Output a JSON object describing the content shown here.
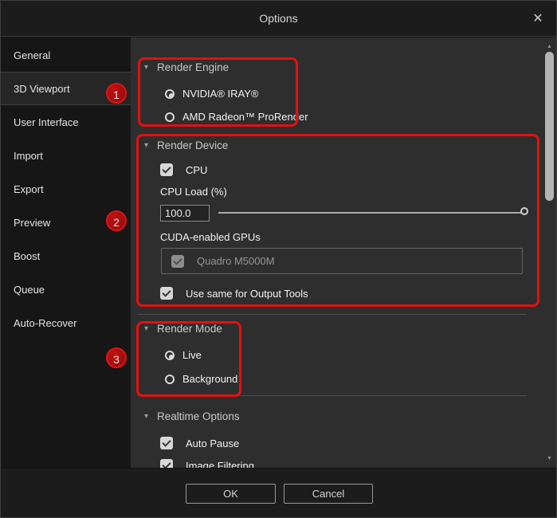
{
  "window": {
    "title": "Options"
  },
  "icons": {
    "close": "✕",
    "collapse": "▾",
    "scroll_up": "▲",
    "scroll_down": "▼"
  },
  "colors": {
    "annotation_red": "#e60f0f",
    "content_bg": "#2e2e2e",
    "sidebar_bg": "#161616",
    "control_fill": "#d7d7d7"
  },
  "sidebar": {
    "selected": "3D Viewport",
    "items": [
      {
        "label": "General"
      },
      {
        "label": "3D Viewport"
      },
      {
        "label": "User Interface"
      },
      {
        "label": "Import"
      },
      {
        "label": "Export"
      },
      {
        "label": "Preview"
      },
      {
        "label": "Boost"
      },
      {
        "label": "Queue"
      },
      {
        "label": "Auto-Recover"
      }
    ]
  },
  "annotations": {
    "badges": [
      {
        "number": "1"
      },
      {
        "number": "2"
      },
      {
        "number": "3"
      }
    ]
  },
  "sections": {
    "render_engine": {
      "title": "Render Engine",
      "options": [
        {
          "label": "NVIDIA® IRAY®",
          "selected": true
        },
        {
          "label": "AMD Radeon™ ProRender",
          "selected": false
        }
      ]
    },
    "render_device": {
      "title": "Render Device",
      "cpu": {
        "label": "CPU",
        "checked": true
      },
      "cpu_load": {
        "label": "CPU Load (%)",
        "value": "100.0",
        "slider_percent": 100
      },
      "cuda_gpus": {
        "label": "CUDA-enabled GPUs",
        "items": [
          {
            "name": "Quadro M5000M",
            "checked": true,
            "enabled": false
          }
        ]
      },
      "use_same": {
        "label": "Use same for Output Tools",
        "checked": true
      }
    },
    "render_mode": {
      "title": "Render Mode",
      "options": [
        {
          "label": "Live",
          "selected": true
        },
        {
          "label": "Background",
          "selected": false
        }
      ]
    },
    "realtime_options": {
      "title": "Realtime Options",
      "items": [
        {
          "label": "Auto Pause",
          "checked": true
        },
        {
          "label": "Image Filtering",
          "checked": true
        }
      ]
    }
  },
  "footer": {
    "ok_label": "OK",
    "cancel_label": "Cancel"
  }
}
